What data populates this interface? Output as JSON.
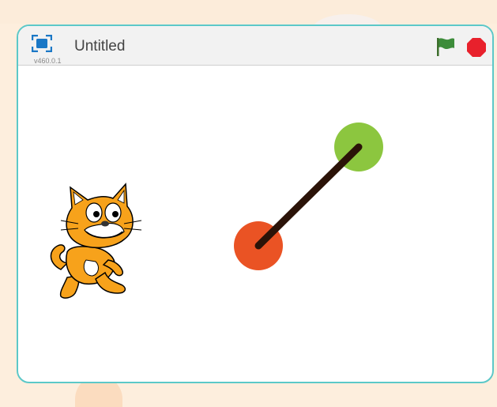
{
  "stage": {
    "title": "Untitled",
    "version": "v460.0.1"
  },
  "colors": {
    "accent_border": "#5cc8c8",
    "flag": "#3d8c3a",
    "stop": "#e8212c",
    "fullscreen": "#1b78c6",
    "dot_start": "#ea5324",
    "dot_end": "#8cc63f",
    "line": "#2b1308",
    "cat_orange": "#f7a21b"
  },
  "icons": {
    "fullscreen": "fullscreen-icon",
    "flag": "green-flag-icon",
    "stop": "stop-sign-icon",
    "sprite": "scratch-cat-sprite"
  }
}
